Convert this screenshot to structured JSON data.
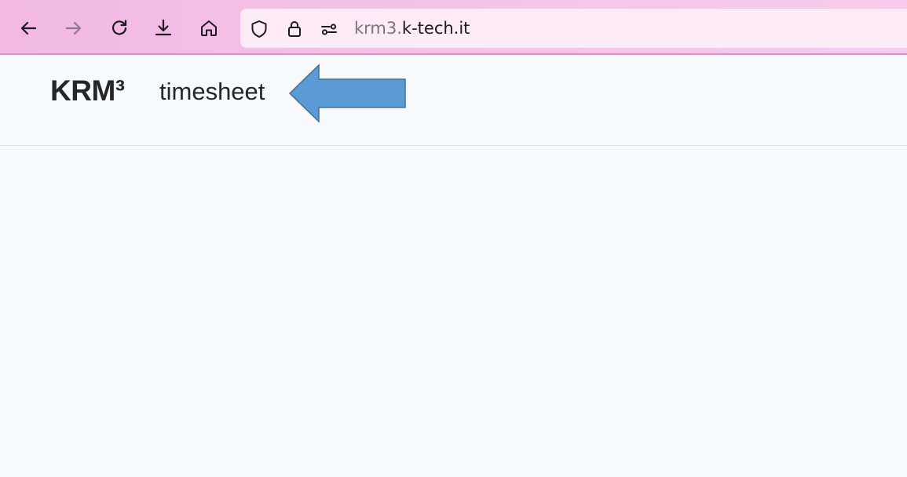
{
  "browser": {
    "url_subdomain": "krm3.",
    "url_domain": "k-tech.it",
    "icons": [
      "back-icon",
      "forward-icon",
      "reload-icon",
      "downloads-icon",
      "home-icon",
      "tracking-shield-icon",
      "lock-icon",
      "permissions-icon"
    ]
  },
  "app": {
    "brand": "KRM³",
    "nav_link": "timesheet"
  },
  "annotation": {
    "arrow_fill": "#5b9bd5",
    "arrow_stroke": "#41719c"
  },
  "colors": {
    "toolbar_accent": "#f3b9e1",
    "page_background": "#f8f9fb"
  }
}
